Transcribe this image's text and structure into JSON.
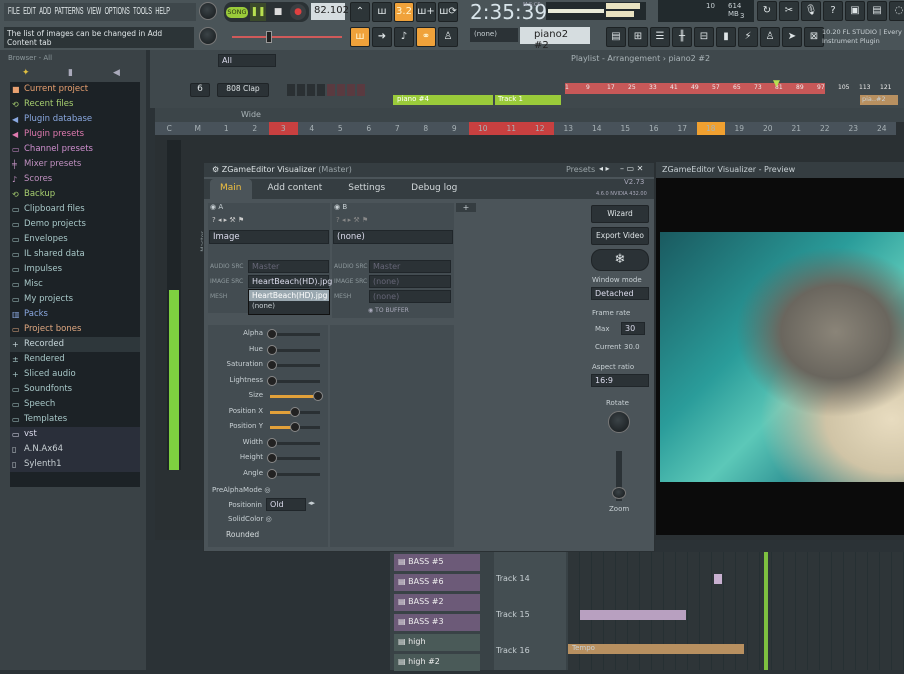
{
  "menu": [
    "FILE",
    "EDIT",
    "ADD",
    "PATTERNS",
    "VIEW",
    "OPTIONS",
    "TOOLS",
    "HELP"
  ],
  "hint": "The list of images can be changed in Add Content tab",
  "transport": {
    "mode": "SONG",
    "tempo": "82.102",
    "time": "2:35:39",
    "time_label": "M:S:CS"
  },
  "cpu": {
    "voices": "10",
    "memory": "614 MB",
    "poly": "3"
  },
  "pattern_selector": {
    "none": "(none)",
    "pattern": "piano2 #2"
  },
  "news": "10.20 FL STUDIO | Every Instrument Plugin",
  "browser": {
    "title": "Browser - All",
    "items": [
      {
        "label": "Current project",
        "color": "#e8a070",
        "icon": "■"
      },
      {
        "label": "Recent files",
        "color": "#a8d070",
        "icon": "⟲"
      },
      {
        "label": "Plugin database",
        "color": "#8aa8e0",
        "icon": "◀"
      },
      {
        "label": "Plugin presets",
        "color": "#e07ab0",
        "icon": "◀"
      },
      {
        "label": "Channel presets",
        "color": "#d090d0",
        "icon": "▭"
      },
      {
        "label": "Mixer presets",
        "color": "#c090c0",
        "icon": "╪"
      },
      {
        "label": "Scores",
        "color": "#c090c0",
        "icon": "♪"
      },
      {
        "label": "Backup",
        "color": "#a8d070",
        "icon": "⟲"
      },
      {
        "label": "Clipboard files",
        "color": "#a8c8c8",
        "icon": "▭"
      },
      {
        "label": "Demo projects",
        "color": "#a8c8c8",
        "icon": "▭"
      },
      {
        "label": "Envelopes",
        "color": "#a8c8c8",
        "icon": "▭"
      },
      {
        "label": "IL shared data",
        "color": "#a8c8c8",
        "icon": "▭"
      },
      {
        "label": "Impulses",
        "color": "#a8c8c8",
        "icon": "▭"
      },
      {
        "label": "Misc",
        "color": "#a8c8c8",
        "icon": "▭"
      },
      {
        "label": "My projects",
        "color": "#a8c8c8",
        "icon": "▭"
      },
      {
        "label": "Packs",
        "color": "#8aa8e0",
        "icon": "▥"
      },
      {
        "label": "Project bones",
        "color": "#e0a880",
        "icon": "▭"
      },
      {
        "label": "Recorded",
        "color": "#c8d8dc",
        "icon": "+"
      },
      {
        "label": "Rendered",
        "color": "#a8c8c8",
        "icon": "±"
      },
      {
        "label": "Sliced audio",
        "color": "#a8c8c8",
        "icon": "+"
      },
      {
        "label": "Soundfonts",
        "color": "#a8c8c8",
        "icon": "▭"
      },
      {
        "label": "Speech",
        "color": "#a8c8c8",
        "icon": "▭"
      },
      {
        "label": "Templates",
        "color": "#a8c8c8",
        "icon": "▭"
      },
      {
        "label": "vst",
        "color": "#dde",
        "icon": "▭"
      },
      {
        "label": "A.N.Ax64",
        "color": "#c8d0d4",
        "icon": "▯"
      },
      {
        "label": "Sylenth1",
        "color": "#c8d0d4",
        "icon": "▯"
      }
    ]
  },
  "channel_rack": {
    "filter": "All",
    "number": "6",
    "channel": "808 Clap"
  },
  "playlist": {
    "title": "Playlist - Arrangement › piano2 #2",
    "track1": "Track 1",
    "pattern": "piano #4",
    "ruler": [
      "1",
      "9",
      "17",
      "25",
      "33",
      "41",
      "49",
      "57",
      "65",
      "73",
      "81",
      "89",
      "97",
      "105",
      "113",
      "121"
    ],
    "clip": "pia..#2"
  },
  "mixer": {
    "preset": "Wide",
    "channels": [
      "C",
      "M",
      "1",
      "2",
      "3",
      "4",
      "5",
      "6",
      "7",
      "8",
      "9",
      "10",
      "11",
      "12",
      "13",
      "14",
      "15",
      "16",
      "17",
      "18",
      "19",
      "20",
      "21",
      "22",
      "23",
      "24"
    ],
    "master_label": "Master"
  },
  "plugin": {
    "title": "ZGameEditor Visualizer",
    "title_sub": "(Master)",
    "presets": "Presets",
    "tabs": [
      "Main",
      "Add content",
      "Settings",
      "Debug log"
    ],
    "version": "V2.73",
    "gl": "4.6.0 NVIDIA 432.00",
    "layerA": {
      "name": "A",
      "effect": "Image",
      "audio_src": "Master",
      "image_src": "HeartBeach(HD).jpg",
      "dropdown": [
        "HeartBeach(HD).jpg",
        "(none)"
      ]
    },
    "layerB": {
      "name": "B",
      "effect": "(none)",
      "audio_src": "Master",
      "image_src": "(none)",
      "mesh": "(none)",
      "to_buffer": "TO BUFFER"
    },
    "labels": {
      "audio_src": "AUDIO SRC",
      "image_src": "IMAGE SRC",
      "mesh": "MESH"
    },
    "sliders": [
      {
        "label": "Alpha",
        "value": 0
      },
      {
        "label": "Hue",
        "value": 0
      },
      {
        "label": "Saturation",
        "value": 0
      },
      {
        "label": "Lightness",
        "value": 0
      },
      {
        "label": "Size",
        "value": 1
      },
      {
        "label": "Position X",
        "value": 0.5
      },
      {
        "label": "Position Y",
        "value": 0.5
      },
      {
        "label": "Width",
        "value": 0
      },
      {
        "label": "Height",
        "value": 0
      },
      {
        "label": "Angle",
        "value": 0
      }
    ],
    "prealpha": "PreAlphaMode",
    "positioning": "Positionin",
    "positioning_value": "Old",
    "solidcolor": "SolidColor",
    "rounded": "Rounded",
    "side": {
      "wizard": "Wizard",
      "export": "Export Video",
      "window_mode": "Window mode",
      "window_mode_value": "Detached",
      "frame_rate": "Frame rate",
      "max": "Max",
      "max_value": "30",
      "current": "Current",
      "current_value": "30.0",
      "aspect": "Aspect ratio",
      "aspect_value": "16:9",
      "rotate": "Rotate",
      "zoom": "Zoom"
    }
  },
  "preview": {
    "title": "ZGameEditor Visualizer - Preview"
  },
  "arrangement": {
    "patterns": [
      "BASS #5",
      "BASS #6",
      "BASS #2",
      "BASS #3",
      "high",
      "high #2"
    ],
    "tracks": [
      "Track 14",
      "Track 15",
      "Track 16"
    ],
    "tempo": "Tempo"
  }
}
